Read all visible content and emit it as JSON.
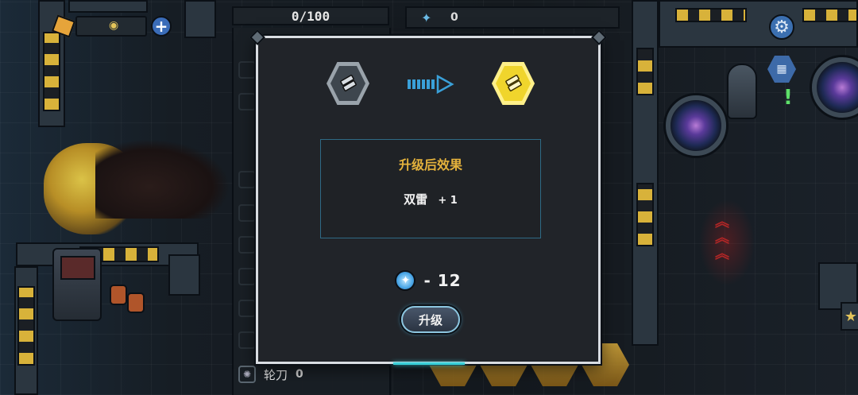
{
  "hud": {
    "capacity_counter": "0/100",
    "gem_count": "0"
  },
  "list_panel": {
    "last_item": {
      "name": "轮刀",
      "count": "0"
    }
  },
  "upgrade_dialog": {
    "from_icon": "weapon-dual-mine-icon",
    "to_icon": "weapon-dual-mine-upgraded-icon",
    "effect_title": "升级后效果",
    "effect_name": "双雷",
    "effect_bonus": "+ 1",
    "cost_text": "- 12",
    "upgrade_button": "升级"
  },
  "colors": {
    "accent_gold": "#e4b23c",
    "accent_cyan": "#39d0d8",
    "dialog_bg": "#212429"
  }
}
